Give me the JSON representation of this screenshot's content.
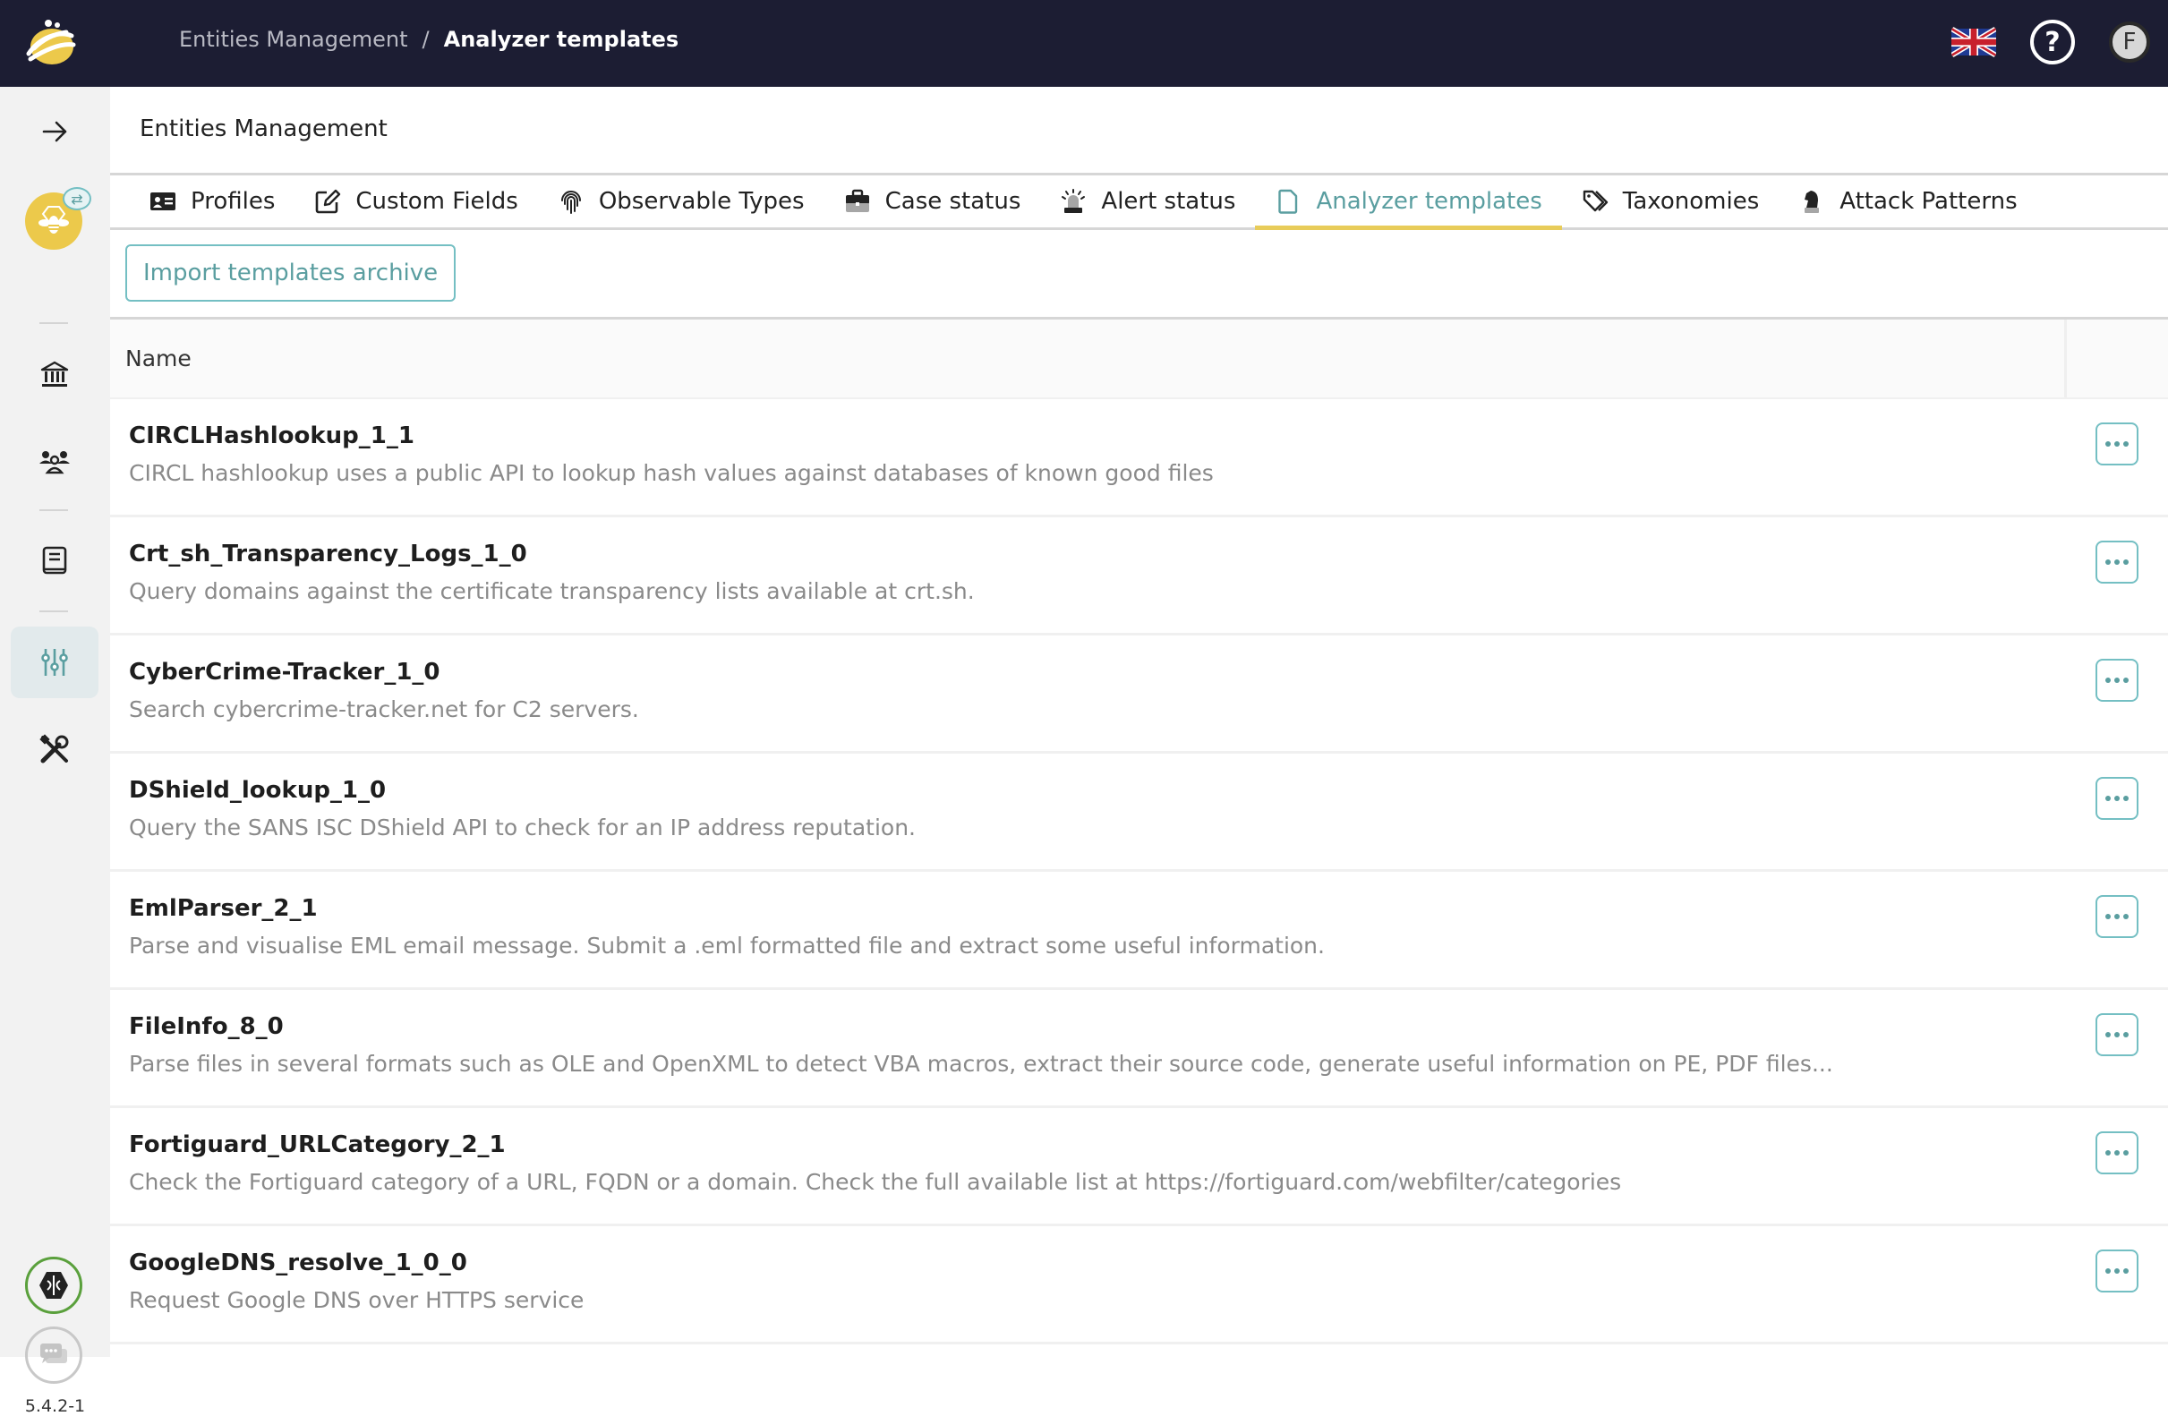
{
  "header": {
    "breadcrumb": [
      "Entities Management",
      "Analyzer templates"
    ],
    "breadcrumb_separator": "/",
    "language_icon": "uk-flag-icon",
    "help_label": "?",
    "avatar_initial": "F"
  },
  "sidebar": {
    "items": [
      {
        "name": "expand",
        "icon": "arrow-right-icon"
      },
      {
        "name": "organisation",
        "icon": "bee-icon"
      },
      {
        "name": "organisations",
        "icon": "bank-icon"
      },
      {
        "name": "users",
        "icon": "users-icon"
      },
      {
        "name": "knowledge-base",
        "icon": "book-icon"
      },
      {
        "name": "entities-management",
        "icon": "sliders-icon",
        "active": true
      },
      {
        "name": "platform-management",
        "icon": "tools-icon"
      }
    ],
    "cortex_icon": "cortex-icon",
    "chat_icon": "chat-icon",
    "version": "5.4.2-1"
  },
  "page": {
    "title": "Entities Management",
    "tabs": [
      {
        "label": "Profiles",
        "icon": "id-card-icon"
      },
      {
        "label": "Custom Fields",
        "icon": "edit-icon"
      },
      {
        "label": "Observable Types",
        "icon": "fingerprint-icon"
      },
      {
        "label": "Case status",
        "icon": "briefcase-icon"
      },
      {
        "label": "Alert status",
        "icon": "siren-icon"
      },
      {
        "label": "Analyzer templates",
        "icon": "file-icon",
        "active": true
      },
      {
        "label": "Taxonomies",
        "icon": "tags-icon"
      },
      {
        "label": "Attack Patterns",
        "icon": "chess-knight-icon"
      }
    ],
    "import_button": "Import templates archive",
    "colors": {
      "accent": "#5a9ea0",
      "active_tab_underline": "#e8cc5a",
      "topbar": "#1c1d33"
    }
  },
  "table": {
    "columns": [
      "Name",
      ""
    ],
    "rows": [
      {
        "name": "CIRCLHashlookup_1_1",
        "description": "CIRCL hashlookup uses a public API to lookup hash values against databases of known good files"
      },
      {
        "name": "Crt_sh_Transparency_Logs_1_0",
        "description": "Query domains against the certificate transparency lists available at crt.sh."
      },
      {
        "name": "CyberCrime-Tracker_1_0",
        "description": "Search cybercrime-tracker.net for C2 servers."
      },
      {
        "name": "DShield_lookup_1_0",
        "description": "Query the SANS ISC DShield API to check for an IP address reputation."
      },
      {
        "name": "EmlParser_2_1",
        "description": "Parse and visualise EML email message. Submit a .eml formatted file and extract some useful information."
      },
      {
        "name": "FileInfo_8_0",
        "description": "Parse files in several formats such as OLE and OpenXML to detect VBA macros, extract their source code, generate useful information on PE, PDF files..."
      },
      {
        "name": "Fortiguard_URLCategory_2_1",
        "description": "Check the Fortiguard category of a URL, FQDN or a domain. Check the full available list at https://fortiguard.com/webfilter/categories"
      },
      {
        "name": "GoogleDNS_resolve_1_0_0",
        "description": "Request Google DNS over HTTPS service"
      }
    ]
  }
}
